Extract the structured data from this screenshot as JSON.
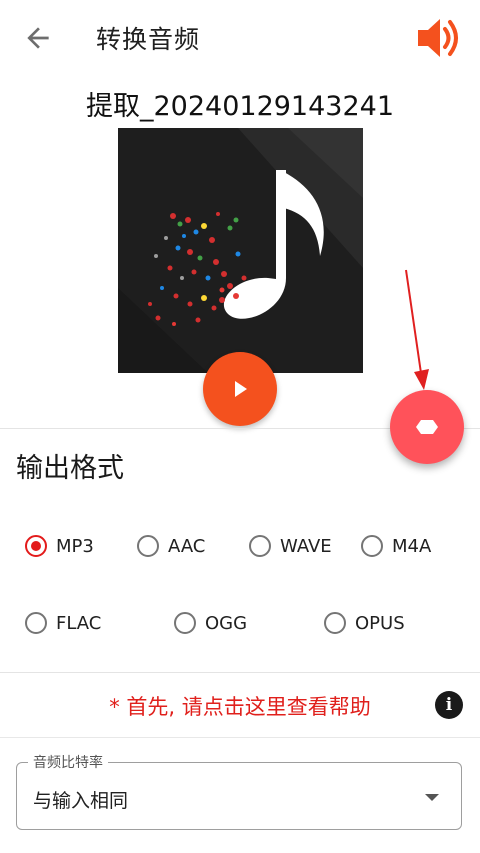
{
  "header": {
    "title": "转换音频",
    "back_icon": "arrow-back-icon",
    "volume_icon": "volume-up-icon",
    "accent_color": "#f4511e"
  },
  "file": {
    "name": "提取_20240129143241"
  },
  "player": {
    "play_icon": "play-icon",
    "fab_icon": "hexagon-icon",
    "fab_color": "#ff525a"
  },
  "output_format": {
    "heading": "输出格式",
    "selected": "MP3",
    "options": [
      "MP3",
      "AAC",
      "WAVE",
      "M4A",
      "FLAC",
      "OGG",
      "OPUS"
    ]
  },
  "help": {
    "text": "* 首先, 请点击这里查看帮助",
    "icon": "info-icon",
    "info_glyph": "i",
    "color": "#e0201c"
  },
  "bitrate": {
    "label": "音频比特率",
    "value": "与输入相同"
  }
}
